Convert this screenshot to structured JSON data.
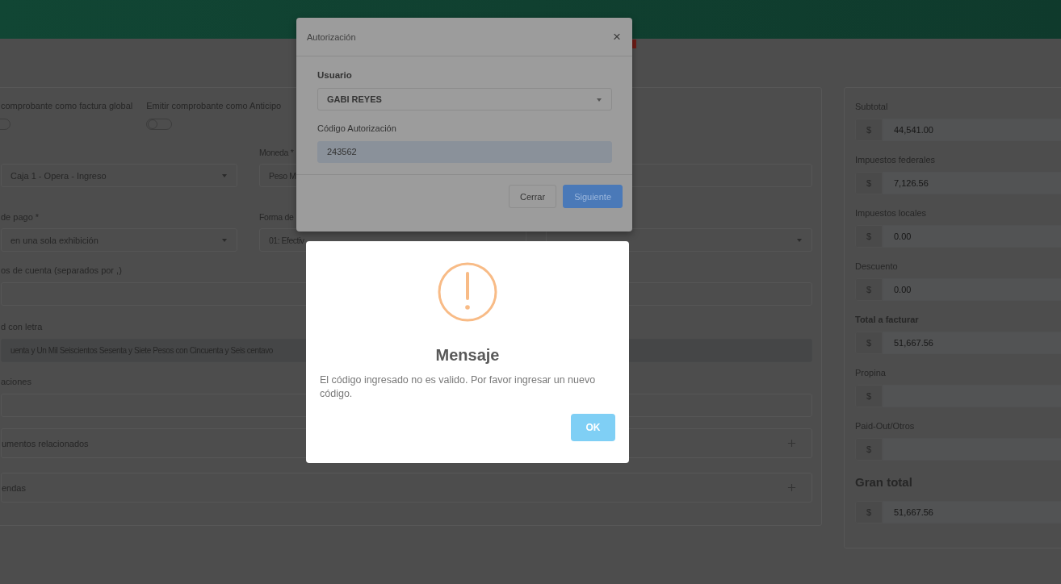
{
  "form": {
    "switches": [
      {
        "label": "comprobante como factura global",
        "on": false
      },
      {
        "label": "Emitir comprobante como Anticipo",
        "on": false
      }
    ],
    "caja": {
      "value": "Caja 1 - Opera - Ingreso"
    },
    "moneda": {
      "label": "Moneda *",
      "value": "Peso M"
    },
    "metodo": {
      "label": "de pago *",
      "value": "en una sola exhibición"
    },
    "forma": {
      "label": "Forma de",
      "value": "01: Efectiv"
    },
    "cuentas": {
      "label": "os de cuenta (separados por ,)"
    },
    "letra": {
      "label": "d con letra",
      "value": "uenta y Un Mil Seiscientos Sesenta y Siete Pesos con Cincuenta y Seis centavo"
    },
    "observaciones": {
      "label": "aciones"
    },
    "sections": [
      {
        "title": "umentos relacionados",
        "expanded": false
      },
      {
        "title": "endas",
        "expanded": false
      }
    ]
  },
  "totals": [
    {
      "label": "Subtotal",
      "kind": "normal",
      "currency": "$",
      "value": "44,541.00"
    },
    {
      "label": "Impuestos federales",
      "kind": "normal",
      "currency": "$",
      "value": "7,126.56"
    },
    {
      "label": "Impuestos locales",
      "kind": "normal",
      "currency": "$",
      "value": "0.00"
    },
    {
      "label": "Descuento",
      "kind": "normal",
      "currency": "$",
      "value": "0.00"
    },
    {
      "label": "Total a facturar",
      "kind": "bold",
      "currency": "$",
      "value": "51,667.56"
    },
    {
      "label": "Propina",
      "kind": "normal",
      "currency": "$"
    },
    {
      "label": "Paid-Out/Otros",
      "kind": "normal",
      "currency": "$"
    },
    {
      "label": "Gran total",
      "kind": "heading",
      "currency": "$",
      "value": "51,667.56"
    }
  ],
  "auth_dialog": {
    "title": "Autorización",
    "close": "×",
    "user_label": "Usuario",
    "user_value": "GABI REYES",
    "code_label": "Código Autorización",
    "code_value": "243562",
    "buttons": [
      {
        "label": "Cerrar",
        "kind": "default"
      },
      {
        "label": "Siguiente",
        "kind": "primary"
      }
    ]
  },
  "alert": {
    "title": "Mensaje",
    "message": "El código ingresado no es valido. Por favor ingresar un nuevo código.",
    "button": "OK"
  }
}
